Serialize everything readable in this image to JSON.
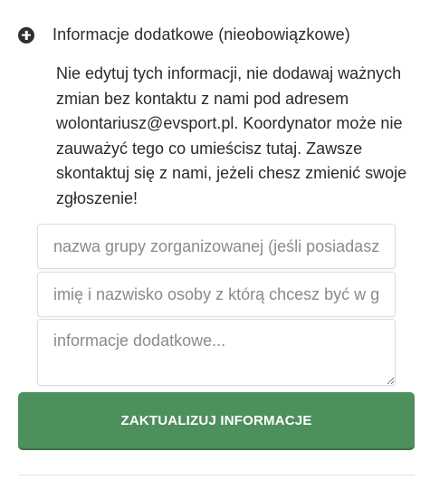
{
  "section": {
    "icon": "plus-circle-icon",
    "title": "Informacje dodatkowe (nieobowiązkowe)"
  },
  "notice": {
    "text": "Nie edytuj tych informacji, nie dodawaj ważnych zmian bez kontaktu z nami pod adresem wolontariusz@evsport.pl. Koordynator może nie zauważyć tego co umieścisz tutaj. Zawsze skontaktuj się z nami, jeżeli chesz zmienić swoje zgłoszenie!"
  },
  "form": {
    "group_placeholder": "nazwa grupy zorganizowanej (jeśli posiadasz)",
    "group_value": "",
    "person_placeholder": "imię i nazwisko osoby z którą chcesz być w grupie",
    "person_value": "",
    "info_placeholder": "informacje dodatkowe...",
    "info_value": ""
  },
  "submit": {
    "label": "ZAKTUALIZUJ INFORMACJE"
  },
  "colors": {
    "button": "#4e8f5e",
    "button_text": "#ffffff",
    "icon": "#2f2f2f"
  }
}
